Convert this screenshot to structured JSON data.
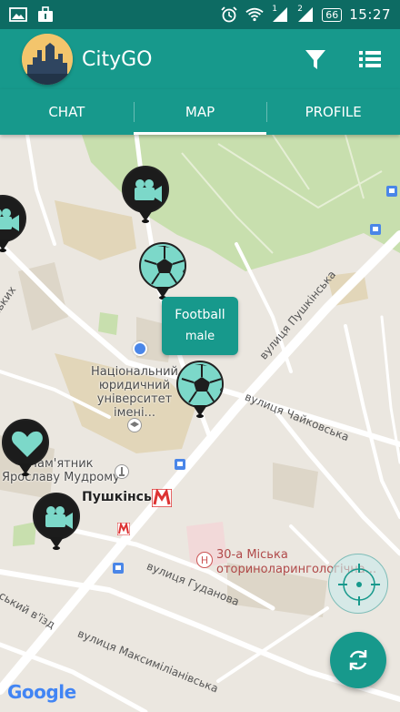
{
  "status_bar": {
    "time": "15:27",
    "battery": "66",
    "sim1": "1",
    "sim2": "2"
  },
  "app": {
    "title": "CityGO"
  },
  "icons": {
    "filter": "filter-icon",
    "list": "list-icon",
    "refresh": "refresh-icon",
    "locate": "crosshair-icon"
  },
  "tabs": [
    {
      "label": "CHAT",
      "active": false
    },
    {
      "label": "MAP",
      "active": true
    },
    {
      "label": "PROFILE",
      "active": false
    }
  ],
  "popup": {
    "title": "Football",
    "subtitle": "male"
  },
  "map": {
    "university": [
      "Національний",
      "юридичний",
      "університет",
      "імені..."
    ],
    "monument": [
      "Пам'ятник",
      "Ярославу Мудрому"
    ],
    "metro": "Пушкінська",
    "hospital": [
      "30-а Міська",
      "оториноларингологічна..."
    ],
    "streets": {
      "pushkinska": "вулиця Пушкінська",
      "chaikovska": "вулиця Чайковська",
      "hudanova": "вулиця Гуданова",
      "maksymilianivska": "вулиця Максиміліанівська",
      "viizd": "ський в'їзд",
      "skykh": "ських"
    },
    "attribution": "Google"
  },
  "colors": {
    "primary": "#17998c",
    "status": "#0d6b63",
    "map_bg": "#ebe7e0",
    "park": "#c8dfae"
  }
}
